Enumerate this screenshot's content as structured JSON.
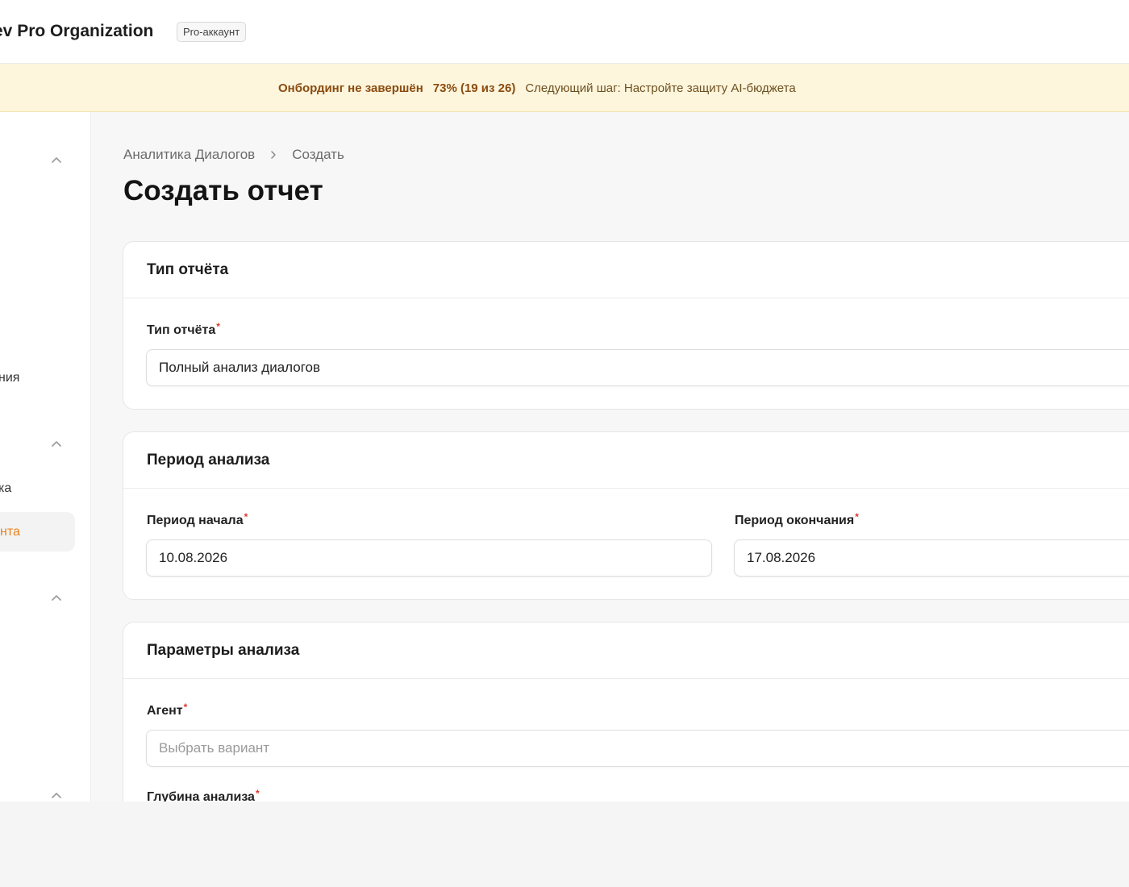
{
  "topbar": {
    "org_name": "ev Pro Organization",
    "badge": "Pro-аккаунт"
  },
  "banner": {
    "title": "Онбординг не завершён",
    "progress_text": "73% (19 из 26)",
    "progress": 0.73,
    "next_step": "Следующий шаг: Настройте защиту AI-бюджета"
  },
  "sidebar": {
    "items": [
      {
        "label": "ния"
      },
      {
        "label": "ка"
      },
      {
        "label": "нта",
        "active": true
      }
    ],
    "accent": "#e8831a"
  },
  "breadcrumb": {
    "parent": "Аналитика Диалогов",
    "current": "Создать"
  },
  "page": {
    "title": "Создать отчет"
  },
  "sections": {
    "report_type": {
      "title": "Тип отчёта",
      "field_label": "Тип отчёта",
      "required_mark": "*",
      "value": "Полный анализ диалогов"
    },
    "period": {
      "title": "Период анализа",
      "start_label": "Период начала",
      "start_value": "10.08.2026",
      "end_label": "Период окончания",
      "end_value": "17.08.2026",
      "required_mark": "*"
    },
    "params": {
      "title": "Параметры анализа",
      "agent_label": "Агент",
      "agent_placeholder": "Выбрать вариант",
      "depth_label": "Глубина анализа",
      "required_mark": "*"
    }
  }
}
